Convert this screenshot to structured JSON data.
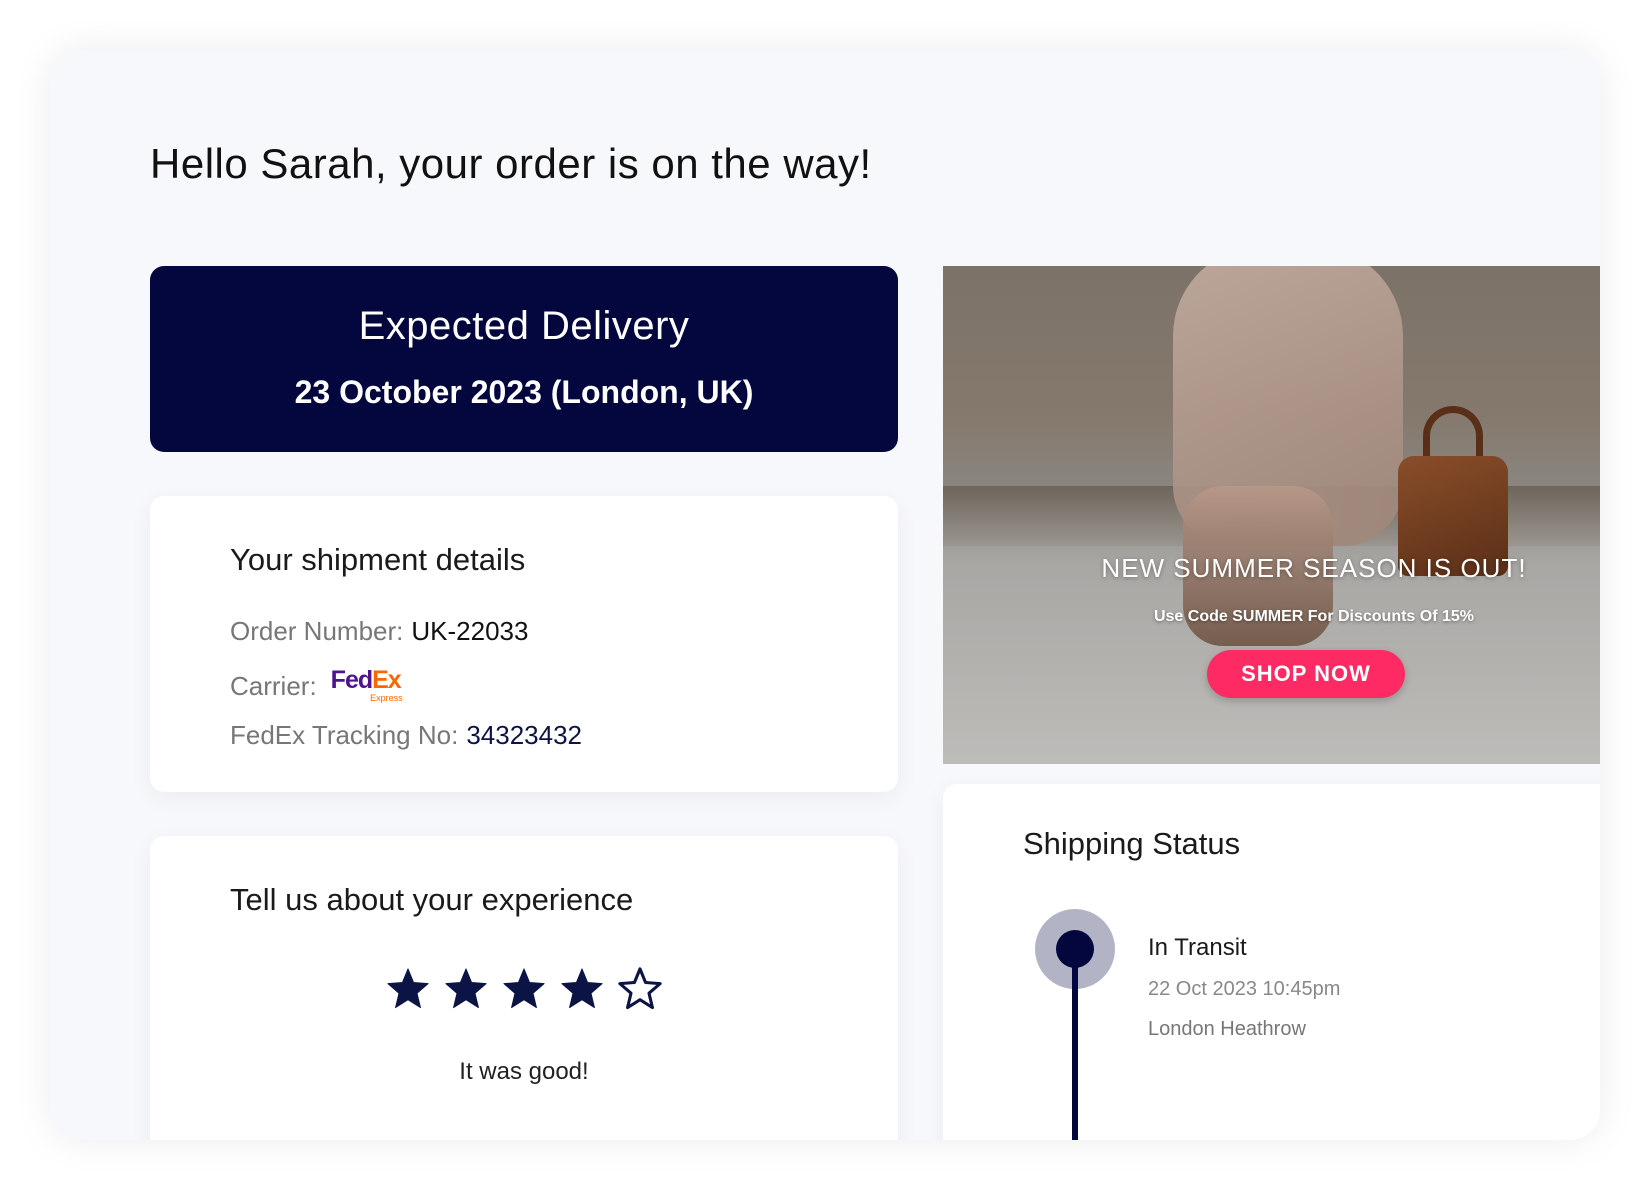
{
  "greeting": "Hello Sarah, your order is on the way!",
  "delivery": {
    "title": "Expected Delivery",
    "date": "23 October 2023 (London, UK)"
  },
  "shipment": {
    "heading": "Your shipment details",
    "order_label": "Order Number:",
    "order_value": "UK-22033",
    "carrier_label": "Carrier:",
    "carrier_logo": {
      "fed": "Fed",
      "ex": "Ex",
      "express": "Express"
    },
    "tracking_label": "FedEx Tracking No:",
    "tracking_value": "34323432"
  },
  "experience": {
    "heading": "Tell us about your experience",
    "rating": 4,
    "max_rating": 5,
    "feedback": "It was good!",
    "star_color": "#0c1446"
  },
  "promo": {
    "title": "NEW SUMMER SEASON IS OUT!",
    "subtitle": "Use Code SUMMER For Discounts Of 15%",
    "button_label": "SHOP NOW",
    "button_color": "#fd2a63"
  },
  "shipping_status": {
    "heading": "Shipping Status",
    "events": [
      {
        "label": "In Transit",
        "time": "22 Oct 2023 10:45pm",
        "location": "London Heathrow"
      }
    ]
  },
  "colors": {
    "navy": "#03073e",
    "accent": "#fd2a63",
    "background": "#f7f8fb"
  }
}
